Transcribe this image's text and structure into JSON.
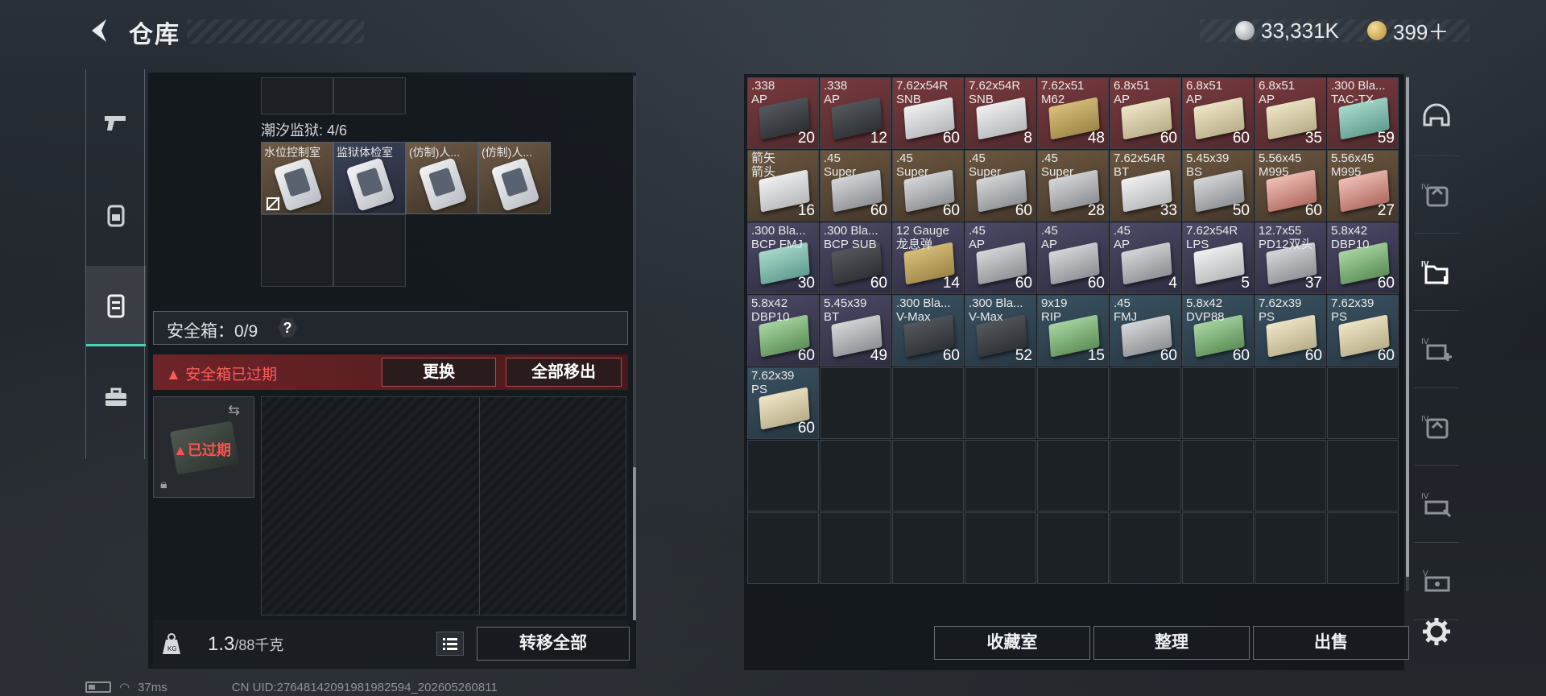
{
  "header": {
    "title": "仓库",
    "currency_silver": "33,331K",
    "currency_gold": "399＋"
  },
  "left_panel": {
    "section_label": "潮汐监狱: 4/6",
    "cards": [
      {
        "label": "水位控制室"
      },
      {
        "label": "监狱体检室"
      },
      {
        "label": "(仿制)人..."
      },
      {
        "label": "(仿制)人..."
      }
    ],
    "safe_box": {
      "label": "安全箱：0/9",
      "help": "?",
      "warning": "安全箱已过期",
      "replace_btn": "更换",
      "remove_all_btn": "全部移出",
      "expired": "已过期"
    },
    "weight": {
      "current": "1.3",
      "max": "/88千克"
    },
    "transfer_all_btn": "转移全部"
  },
  "right_panel": {
    "items": [
      {
        "name": ".338\nAP",
        "count": "20",
        "bg": "red",
        "box": "dark"
      },
      {
        "name": ".338\nAP",
        "count": "12",
        "bg": "red",
        "box": "dark"
      },
      {
        "name": "7.62x54R\nSNB",
        "count": "60",
        "bg": "red",
        "box": "white"
      },
      {
        "name": "7.62x54R\nSNB",
        "count": "8",
        "bg": "red",
        "box": "white"
      },
      {
        "name": "7.62x51\nM62",
        "count": "48",
        "bg": "red",
        "box": "tan"
      },
      {
        "name": "6.8x51\nAP",
        "count": "60",
        "bg": "red",
        "box": "cream"
      },
      {
        "name": "6.8x51\nAP",
        "count": "60",
        "bg": "red",
        "box": "cream"
      },
      {
        "name": "6.8x51\nAP",
        "count": "35",
        "bg": "red",
        "box": "cream"
      },
      {
        "name": ".300 Bla...\nTAC-TX",
        "count": "59",
        "bg": "red",
        "box": "teal"
      },
      {
        "name": "箭矢\n箭头",
        "count": "16",
        "bg": "gold",
        "box": "white"
      },
      {
        "name": ".45\nSuper",
        "count": "60",
        "bg": "gold",
        "box": "gray"
      },
      {
        "name": ".45\nSuper",
        "count": "60",
        "bg": "gold",
        "box": "gray"
      },
      {
        "name": ".45\nSuper",
        "count": "60",
        "bg": "gold",
        "box": "gray"
      },
      {
        "name": ".45\nSuper",
        "count": "28",
        "bg": "gold",
        "box": "gray"
      },
      {
        "name": "7.62x54R\nBT",
        "count": "33",
        "bg": "gold",
        "box": "white"
      },
      {
        "name": "5.45x39\nBS",
        "count": "50",
        "bg": "gold",
        "box": "gray"
      },
      {
        "name": "5.56x45\nM995",
        "count": "60",
        "bg": "gold",
        "box": "redb"
      },
      {
        "name": "5.56x45\nM995",
        "count": "27",
        "bg": "gold",
        "box": "redb"
      },
      {
        "name": ".300 Bla...\nBCP FMJ",
        "count": "30",
        "bg": "purple",
        "box": "teal"
      },
      {
        "name": ".300 Bla...\nBCP SUB",
        "count": "60",
        "bg": "purple",
        "box": "dark"
      },
      {
        "name": "12 Gauge\n龙息弹",
        "count": "14",
        "bg": "purple",
        "box": "tan"
      },
      {
        "name": ".45\nAP",
        "count": "60",
        "bg": "purple",
        "box": "gray"
      },
      {
        "name": ".45\nAP",
        "count": "60",
        "bg": "purple",
        "box": "gray"
      },
      {
        "name": ".45\nAP",
        "count": "4",
        "bg": "purple",
        "box": "gray"
      },
      {
        "name": "7.62x54R\nLPS",
        "count": "5",
        "bg": "purple",
        "box": "white"
      },
      {
        "name": "12.7x55\nPD12双头",
        "count": "37",
        "bg": "purple",
        "box": "gray"
      },
      {
        "name": "5.8x42\nDBP10",
        "count": "60",
        "bg": "purple",
        "box": "greenb"
      },
      {
        "name": "5.8x42\nDBP10",
        "count": "60",
        "bg": "purple",
        "box": "greenb"
      },
      {
        "name": "5.45x39\nBT",
        "count": "49",
        "bg": "purple",
        "box": "gray"
      },
      {
        "name": ".300 Bla...\nV-Max",
        "count": "60",
        "bg": "blue",
        "box": "dark"
      },
      {
        "name": ".300 Bla...\nV-Max",
        "count": "52",
        "bg": "blue",
        "box": "dark"
      },
      {
        "name": "9x19\nRIP",
        "count": "15",
        "bg": "blue",
        "box": "greenb"
      },
      {
        "name": ".45\nFMJ",
        "count": "60",
        "bg": "blue",
        "box": "gray"
      },
      {
        "name": "5.8x42\nDVP88",
        "count": "60",
        "bg": "blue",
        "box": "greenb"
      },
      {
        "name": "7.62x39\nPS",
        "count": "60",
        "bg": "blue",
        "box": "cream"
      },
      {
        "name": "7.62x39\nPS",
        "count": "60",
        "bg": "blue",
        "box": "cream"
      },
      {
        "name": "7.62x39\nPS",
        "count": "60",
        "bg": "blue",
        "box": "cream"
      }
    ],
    "buttons": {
      "collection": "收藏室",
      "sort": "整理",
      "sell": "出售"
    }
  },
  "status": {
    "ping": "37ms",
    "uid": "CN UID:27648142091981982594_202605260811"
  },
  "colors": {
    "accent": "#4fd1b3",
    "warning": "#ff5050"
  },
  "icons": {
    "left_sidebar": [
      "pistol-icon",
      "backpack-icon",
      "vest-icon",
      "toolbox-icon"
    ],
    "right_sidebar": [
      "helmet-icon",
      "iv-armor-icon",
      "iv-folder-icon",
      "iv-medkit-icon",
      "iv-armor-icon-2",
      "iv-gear-icon",
      "v-case-icon"
    ]
  }
}
